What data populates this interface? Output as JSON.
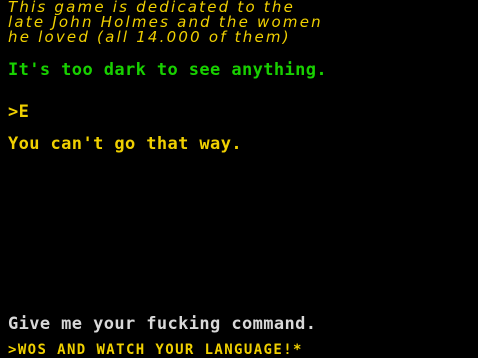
{
  "colors": {
    "background": "#000000",
    "dedication": "#f0d000",
    "room_text": "#18d000",
    "prompt": "#f0d000",
    "response": "#f0d000",
    "request": "#d8d8d8",
    "input": "#f0d000"
  },
  "dedication": {
    "line1": "This game is dedicated to the",
    "line2": "late John Holmes and the women",
    "line3": "he loved (all 14.000 of them)"
  },
  "room": {
    "description": "It's too dark to see anything."
  },
  "history": {
    "prompt_command": ">E",
    "response": "You can't go that way."
  },
  "command_request": "Give me your fucking command.",
  "input": {
    "text": ">WOS AND WATCH YOUR LANGUAGE!*"
  }
}
